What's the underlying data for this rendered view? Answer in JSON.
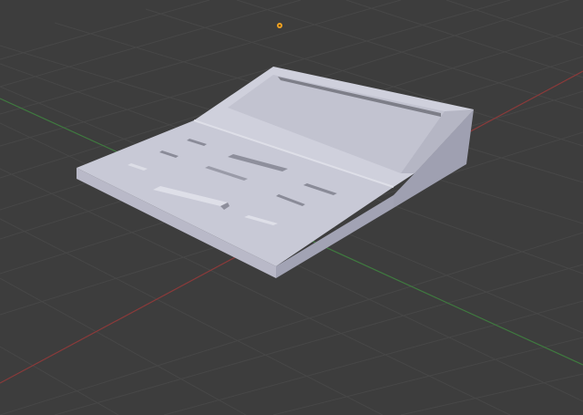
{
  "viewport": {
    "type": "3d-viewport",
    "background_color": "#3d3d3d",
    "grid": true,
    "grid_color": "#4a4a4a",
    "x_axis_color": "#8a3a3a",
    "y_axis_color": "#3f7a3f",
    "light_color": "#f5a623"
  },
  "scene": {
    "object": {
      "icon": "calculator-model",
      "color": "#c8c9d6",
      "keys": 9
    }
  }
}
